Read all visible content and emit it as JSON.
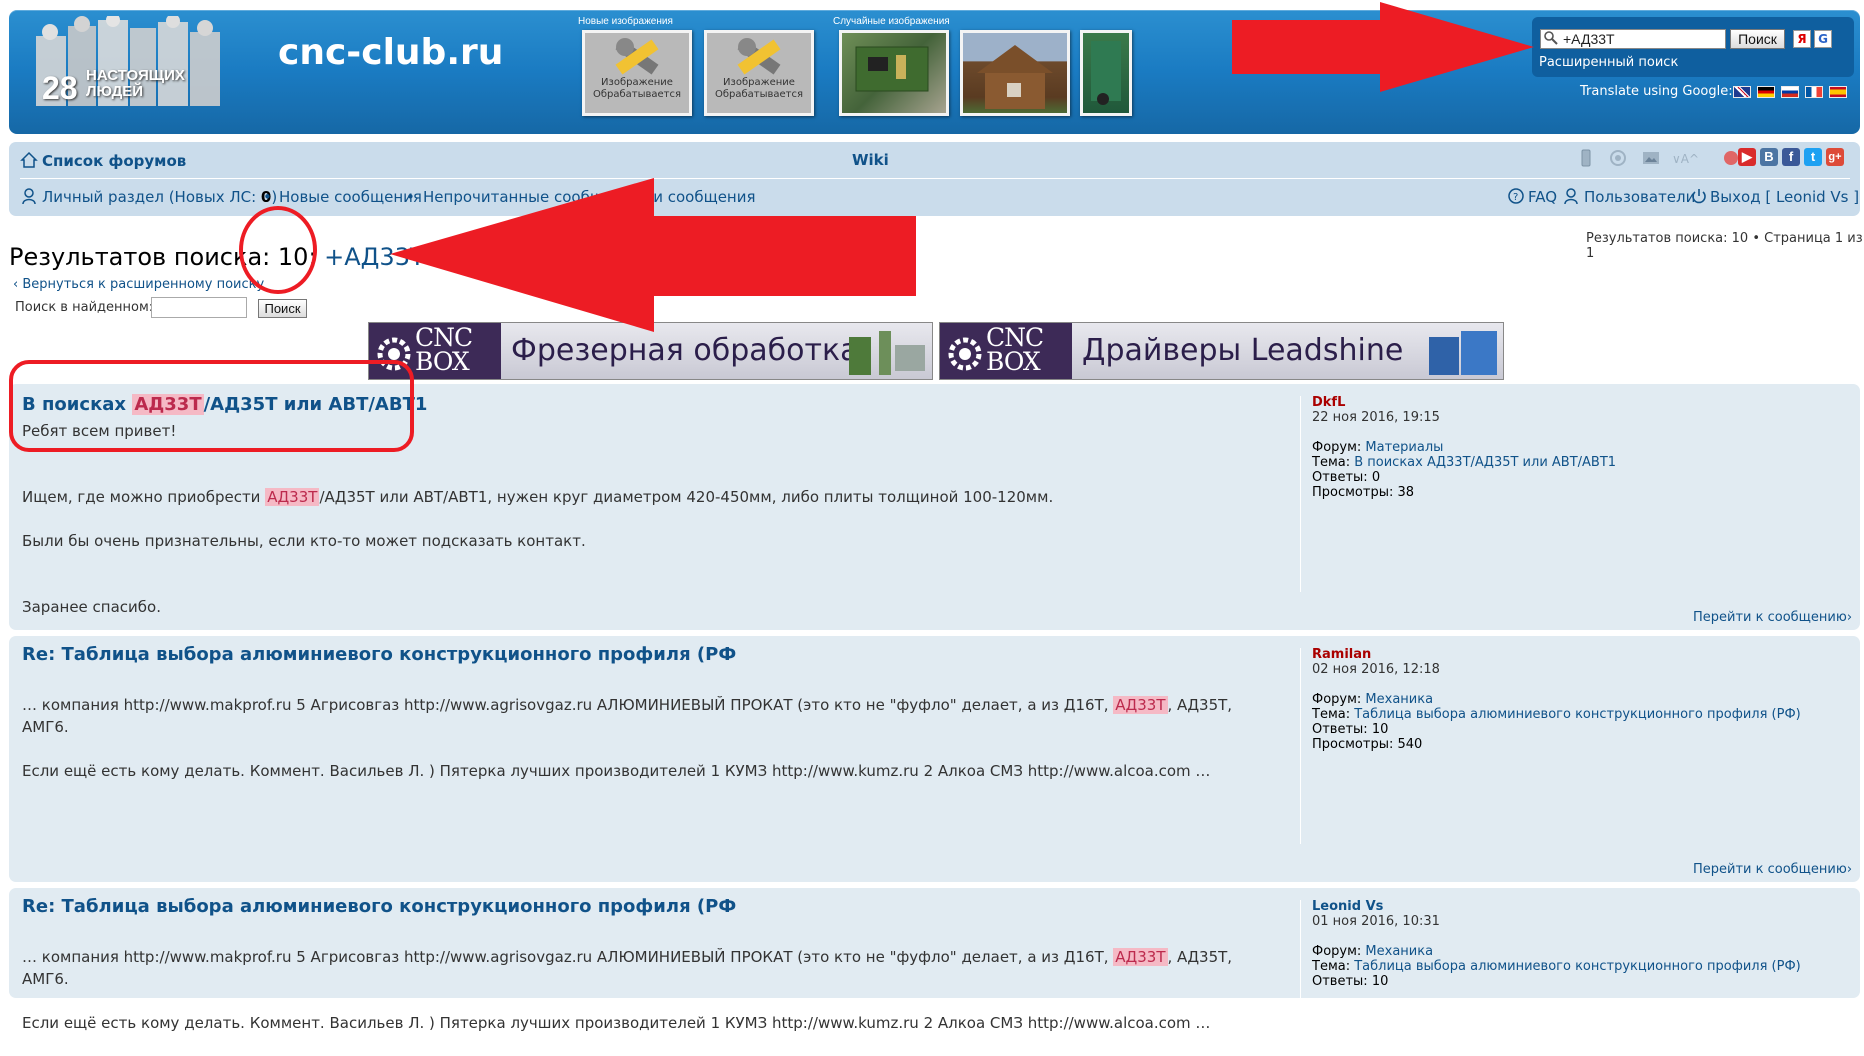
{
  "header": {
    "site_title": "cnc-club.ru",
    "logo": {
      "number": "28",
      "words": "НАСТОЯЩИХ ЛЮДЕЙ"
    },
    "new_images_label": "Новые изображения",
    "random_images_label": "Случайные изображения",
    "processing_caption": "Изображение Обрабатывается",
    "search": {
      "value": "+АД33Т",
      "button_label": "Поиск",
      "advanced_label": "Расширенный поиск",
      "yandex_icon": "Я",
      "google_icon": "G"
    },
    "translate_label": "Translate using Google:",
    "flags": [
      "en",
      "de",
      "ru",
      "fr",
      "es"
    ]
  },
  "navbar": {
    "forums_label": "Список форумов",
    "wiki_label": "Wiki",
    "tools": [
      "mobile-icon",
      "help-circle-icon",
      "image-icon",
      "font-size-icon",
      "font-tool-icon"
    ],
    "social": [
      {
        "name": "youtube",
        "glyph": "▶",
        "color": "#d92b2b"
      },
      {
        "name": "vk",
        "glyph": "B",
        "color": "#4c75a3"
      },
      {
        "name": "facebook",
        "glyph": "f",
        "color": "#3b5998"
      },
      {
        "name": "twitter",
        "glyph": "t",
        "color": "#1da1f2"
      },
      {
        "name": "google-plus",
        "glyph": "g+",
        "color": "#dd4b39"
      }
    ],
    "personal_label": "Личный раздел (Новых ЛС: ",
    "personal_count": "0",
    "personal_close": ")",
    "bullet": " • ",
    "new_posts_label": "Новые сообщения",
    "unread_label": "Непрочитанные сообщения",
    "your_posts_label": "Ваши сообщения",
    "faq_label": "FAQ",
    "users_label": "Пользователи",
    "logout_label": "Выход [ Leonid Vs ]"
  },
  "results": {
    "title_prefix": "Результатов поиска: 10: ",
    "query": "+АД33Т",
    "page_info": "Результатов поиска: 10 • Страница 1 из 1",
    "back_label": "Вернуться к расширенному поиску",
    "search_in_label": "Поиск в найденном:",
    "search_in_button": "Поиск"
  },
  "banners": [
    {
      "brand_top": "CNC",
      "brand_bottom": "BOX",
      "title": "Фрезерная обработка"
    },
    {
      "brand_top": "CNC",
      "brand_bottom": "BOX",
      "title": "Драйверы Leadshine"
    }
  ],
  "posts": [
    {
      "title_before": "В поисках ",
      "title_hl": "АД33Т",
      "title_after": "/АД35Т или АВТ/АВТ1",
      "greeting": "Ребят всем привет!",
      "body_before": "Ищем, где можно приобрести ",
      "body_hl": "АД33Т",
      "body_after": "/АД35Т или АВТ/АВТ1, нужен круг диаметром 420-450мм, либо плиты толщиной 100-120мм.",
      "body_line2": "Были бы очень признательны, если кто-то может подсказать контакт.",
      "body_line3": "Заранее спасибо.",
      "author": "DkfL",
      "date": "22 ноя 2016, 19:15",
      "forum_label": "Форум: ",
      "forum": "Материалы",
      "topic_label": "Тема: ",
      "topic": "В поисках АД33Т/АД35Т или АВТ/АВТ1",
      "replies_label": "Ответы: ",
      "replies": "0",
      "views_label": "Просмотры: ",
      "views": "38",
      "goto_label": "Перейти к сообщению"
    },
    {
      "title": "Re: Таблица выбора алюминиевого конструкционного профиля (РФ",
      "body_before": "… компания http://www.makprof.ru 5 Агрисовгаз http://www.agrisovgaz.ru АЛЮМИНИЕВЫЙ ПРОКАТ (это кто не \"фуфло\" делает, а из Д16Т, ",
      "body_hl": "АД33Т",
      "body_after": ", АД35Т, АМГ6.",
      "body_line2": "Если ещё есть кому делать. Коммент. Васильев Л. ) Пятерка лучших производителей 1 КУМЗ http://www.kumz.ru 2 Алкоа СМЗ http://www.alcoa.com …",
      "author": "Ramilan",
      "date": "02 ноя 2016, 12:18",
      "forum_label": "Форум: ",
      "forum": "Механика",
      "topic_label": "Тема: ",
      "topic": "Таблица выбора алюминиевого конструкционного профиля (РФ)",
      "replies_label": "Ответы: ",
      "replies": "10",
      "views_label": "Просмотры: ",
      "views": "540",
      "goto_label": "Перейти к сообщению"
    },
    {
      "title": "Re: Таблица выбора алюминиевого конструкционного профиля (РФ",
      "body_before": "… компания http://www.makprof.ru 5 Агрисовгаз http://www.agrisovgaz.ru АЛЮМИНИЕВЫЙ ПРОКАТ (это кто не \"фуфло\" делает, а из Д16Т, ",
      "body_hl": "АД33Т",
      "body_after": ", АД35Т, АМГ6.",
      "body_line2": "Если ещё есть кому делать. Коммент. Васильев Л. ) Пятерка лучших производителей 1 КУМЗ http://www.kumz.ru 2 Алкоа СМЗ http://www.alcoa.com …",
      "author": "Leonid Vs",
      "date": "01 ноя 2016, 10:31",
      "forum_label": "Форум: ",
      "forum": "Механика",
      "topic_label": "Тема: ",
      "topic": "Таблица выбора алюминиевого конструкционного профиля (РФ)",
      "replies_label": "Ответы: ",
      "replies": "10"
    }
  ],
  "colors": {
    "header_blue": "#1a7bc2",
    "nav_bg": "#cadceb",
    "post_bg": "#e1ebf2",
    "link": "#105289",
    "highlight_bg": "#f5b9c5",
    "annotation_red": "#ed1c24"
  }
}
